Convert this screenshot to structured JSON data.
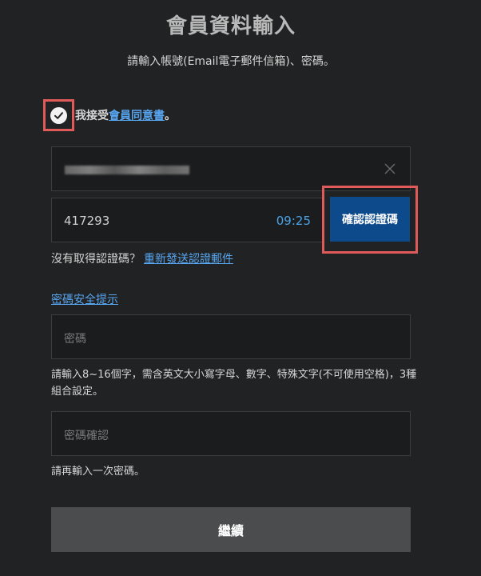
{
  "header": {
    "title": "會員資料輸入",
    "subtitle": "請輸入帳號(Email電子郵件信箱)、密碼。"
  },
  "agreement": {
    "prefix": "我接受",
    "link": "會員同意書",
    "suffix": "。",
    "checked": true
  },
  "email_field": {
    "value_redacted": true,
    "clear_icon": "close-icon"
  },
  "code_field": {
    "value": "417293",
    "timer": "09:25"
  },
  "verify_button": {
    "label": "確認認證碼"
  },
  "resend": {
    "text": "沒有取得認證碼？",
    "link": "重新發送認證郵件"
  },
  "password_tips_link": "密碼安全提示",
  "password_field": {
    "placeholder": "密碼"
  },
  "password_hint": "請輸入8~16個字，需含英文大小寫字母、數字、特殊文字(不可使用空格)，3種組合設定。",
  "confirm_field": {
    "placeholder": "密碼確認"
  },
  "confirm_hint": "請再輸入一次密碼。",
  "continue_button": {
    "label": "繼續"
  },
  "colors": {
    "background": "#202223",
    "accent_link": "#58a6f0",
    "timer": "#4aa3e6",
    "verify_button": "#0d4a8c",
    "highlight": "#e05a5a"
  }
}
